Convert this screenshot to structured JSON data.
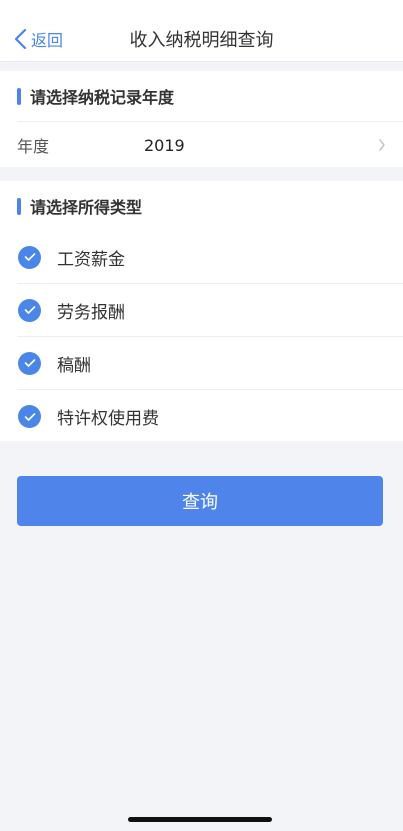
{
  "header": {
    "back_label": "返回",
    "title": "收入纳税明细查询"
  },
  "year_section": {
    "title": "请选择纳税记录年度",
    "label": "年度",
    "value": "2019"
  },
  "type_section": {
    "title": "请选择所得类型",
    "items": [
      {
        "label": "工资薪金",
        "checked": true
      },
      {
        "label": "劳务报酬",
        "checked": true
      },
      {
        "label": "稿酬",
        "checked": true
      },
      {
        "label": "特许权使用费",
        "checked": true
      }
    ]
  },
  "query_button": {
    "label": "查询"
  },
  "colors": {
    "accent": "#4a85e8",
    "button": "#4f85ea",
    "background": "#f3f4f8"
  }
}
